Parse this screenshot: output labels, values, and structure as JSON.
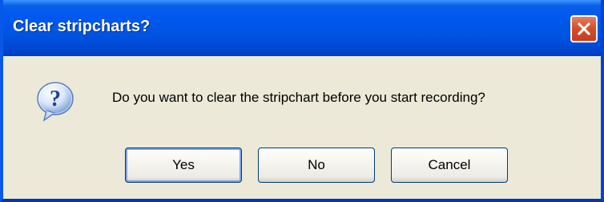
{
  "window": {
    "title": "Clear stripcharts?",
    "close_icon": "close-icon"
  },
  "dialog": {
    "icon": "question-icon",
    "message": "Do you want to clear the stripchart before you start recording?"
  },
  "buttons": {
    "yes": "Yes",
    "no": "No",
    "cancel": "Cancel"
  },
  "colors": {
    "titlebar": "#0054e3",
    "dialog_background": "#ece9d8",
    "close_button": "#d6502d",
    "button_border": "#003c74"
  }
}
